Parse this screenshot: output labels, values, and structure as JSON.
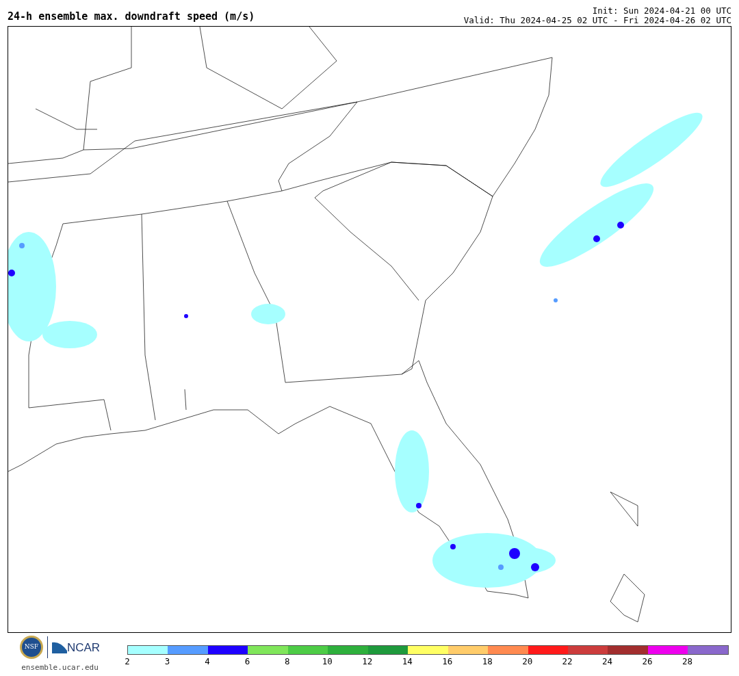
{
  "title": "24-h ensemble max. downdraft speed (m/s)",
  "init": "Init: Sun 2024-04-21 00 UTC",
  "valid": "Valid: Thu 2024-04-25 02 UTC - Fri 2024-04-26 02 UTC",
  "logos": {
    "nsf": "NSF",
    "ncar": "NCAR",
    "url": "ensemble.ucar.edu"
  },
  "colorbar": {
    "bins": [
      {
        "color": "#a6ffff",
        "tick": "2"
      },
      {
        "color": "#569cff",
        "tick": "3"
      },
      {
        "color": "#1e00ff",
        "tick": "4"
      },
      {
        "color": "#80e65a",
        "tick": "6"
      },
      {
        "color": "#4dcc46",
        "tick": "8"
      },
      {
        "color": "#2eb03c",
        "tick": "10"
      },
      {
        "color": "#1e9a3c",
        "tick": "12"
      },
      {
        "color": "#ffff64",
        "tick": "14"
      },
      {
        "color": "#ffcc6a",
        "tick": "16"
      },
      {
        "color": "#ff8a50",
        "tick": "18"
      },
      {
        "color": "#ff1a1a",
        "tick": "20"
      },
      {
        "color": "#cc3c3c",
        "tick": "22"
      },
      {
        "color": "#a22e2e",
        "tick": "24"
      },
      {
        "color": "#ee00ee",
        "tick": "26"
      },
      {
        "color": "#8a68cc",
        "tick": "28"
      }
    ]
  }
}
